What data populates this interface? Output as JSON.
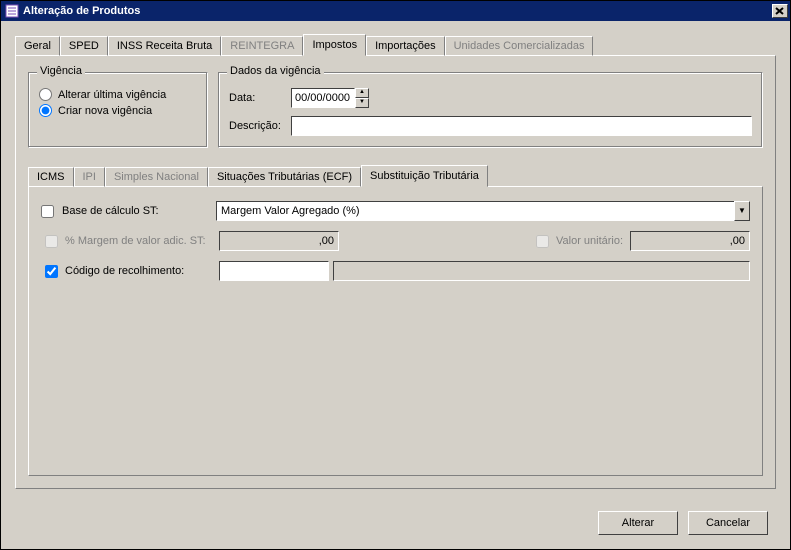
{
  "window": {
    "title": "Alteração de Produtos",
    "close_glyph": "✕"
  },
  "outer_tabs": {
    "geral": "Geral",
    "sped": "SPED",
    "inss": "INSS Receita Bruta",
    "reintegra": "REINTEGRA",
    "impostos": "Impostos",
    "importacoes": "Importações",
    "unidades": "Unidades Comercializadas"
  },
  "vigencia_box": {
    "legend": "Vigência",
    "opt_alterar": "Alterar última vigência",
    "opt_criar": "Criar nova vigência"
  },
  "dados_box": {
    "legend": "Dados da vigência",
    "lbl_data": "Data:",
    "data_value": "00/00/0000",
    "lbl_descr": "Descrição:",
    "descr_value": ""
  },
  "inner_tabs": {
    "icms": "ICMS",
    "ipi": "IPI",
    "simples": "Simples Nacional",
    "sit": "Situações Tributárias (ECF)",
    "subst": "Substituição Tributária"
  },
  "subst_panel": {
    "lbl_base": "Base de cálculo ST:",
    "combo_base": "Margem Valor Agregado (%)",
    "lbl_margem": "% Margem de valor adic. ST:",
    "val_margem": ",00",
    "lbl_valor_unit": "Valor unitário:",
    "val_valor_unit": ",00",
    "lbl_codigo": "Código de recolhimento:",
    "val_codigo": "",
    "val_codigo2": ""
  },
  "buttons": {
    "alterar": "Alterar",
    "cancelar": "Cancelar"
  }
}
